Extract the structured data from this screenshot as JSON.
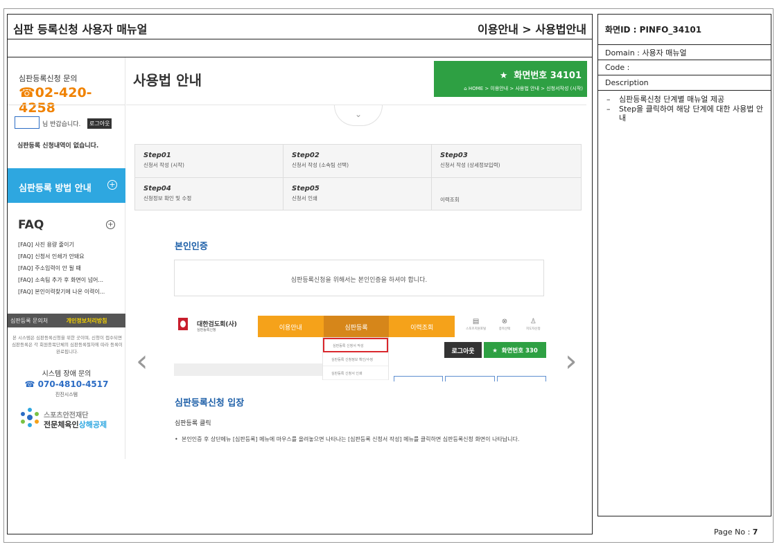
{
  "doc": {
    "title_left": "심판 등록신청 사용자 매뉴얼",
    "title_right": "이용안내 > 사용법안내"
  },
  "meta": {
    "screen_id": "화면ID : PINFO_34101",
    "domain": "Domain : 사용자 매뉴얼",
    "code": "Code :",
    "description_label": "Description",
    "desc_items": [
      "심판등록신청 단계별 매뉴얼 제공",
      "Step을 클릭하여 해당 단계에 대한 사용법 안내"
    ],
    "page_label": "Page No : ",
    "page_num": "7"
  },
  "sidebar": {
    "contact_label": "심판등록신청 문의",
    "contact_phone": "02-420-4258",
    "greeting": "님 반갑습니다.",
    "logout": "로그아웃",
    "no_history": "심판등록 신청내역이 없습니다.",
    "guide_button": "심판등록 방법 안내",
    "faq_title": "FAQ",
    "faq_items": [
      "[FAQ]  사진 용량 줄이기",
      "[FAQ]  신청서 인쇄가 안돼요",
      "[FAQ]  주소입력이 안 될 때",
      "[FAQ]  소속팀 추가 후 화면이 넘어...",
      "[FAQ]  본인이력찾기에 나온 이력이..."
    ],
    "bar_left": "심판등록 문의처",
    "bar_right": "개인정보처리방침",
    "note": "본 시스템은 심판등록신청을 위한 곳이며, 신청이 접수되면 심판등록은 각 회원종목단체의 심판등록절차에 따라 등록이 완료됩니다.",
    "sys_label": "시스템 장애 문의",
    "sys_phone": "070-4810-4517",
    "sys_company": "진진시스템",
    "org_line1": "스포츠안전재단",
    "org_line2a": "전문체육인",
    "org_line2b": "상해공제"
  },
  "main": {
    "page_title": "사용법 안내",
    "banner_title": "화면번호 34101",
    "banner_crumb": "HOME > 이용안내 > 사용법 안내 > 신청서작성 (시작)",
    "steps": [
      {
        "name": "Step01",
        "desc": "신청서 작성 (시작)"
      },
      {
        "name": "Step02",
        "desc": "신청서 작성 (소속팀 선택)"
      },
      {
        "name": "Step03",
        "desc": "신청서 작성 (상세정보입력)"
      },
      {
        "name": "Step04",
        "desc": "신청정보 확인 및 수정"
      },
      {
        "name": "Step05",
        "desc": "신청서 인쇄"
      },
      {
        "name": "",
        "desc": "이력조회"
      }
    ],
    "section1_title": "본인인증",
    "auth_message": "심판등록신청을 위해서는 본인인증을 하셔야 합니다.",
    "embedded": {
      "org_name": "대한검도회(사)",
      "org_sub": "심판등록신청",
      "nav": [
        "이용안내",
        "심판등록",
        "이력조회"
      ],
      "icons": [
        {
          "icon": "document-icon",
          "label": "스포츠지원포털"
        },
        {
          "icon": "close-circle-icon",
          "label": "종목선택"
        },
        {
          "icon": "user-icon",
          "label": "지도자신청"
        }
      ],
      "dropdown": [
        "심판등록 신청서 작성",
        "심판등록 신청정보 확인/수정",
        "심판등록 신청서 인쇄"
      ],
      "logout": "로그아웃",
      "green_button": "화면번호 330"
    },
    "section2_title": "심판등록신청 입장",
    "click_label": "심판등록 클릭",
    "bullet_text": "본인인증 후 상단메뉴 [심판등록] 메뉴에 마우스를 올려놓으면 나타나는 [심판등록 신청서 작성] 메뉴를 클릭하면 심판등록신청 화면이 나타납니다."
  },
  "colors": {
    "accent_blue": "#2ea7e0",
    "green": "#2ea043",
    "orange": "#f5a21a",
    "phone_orange": "#f08200",
    "highlight_red": "#d9262c"
  }
}
